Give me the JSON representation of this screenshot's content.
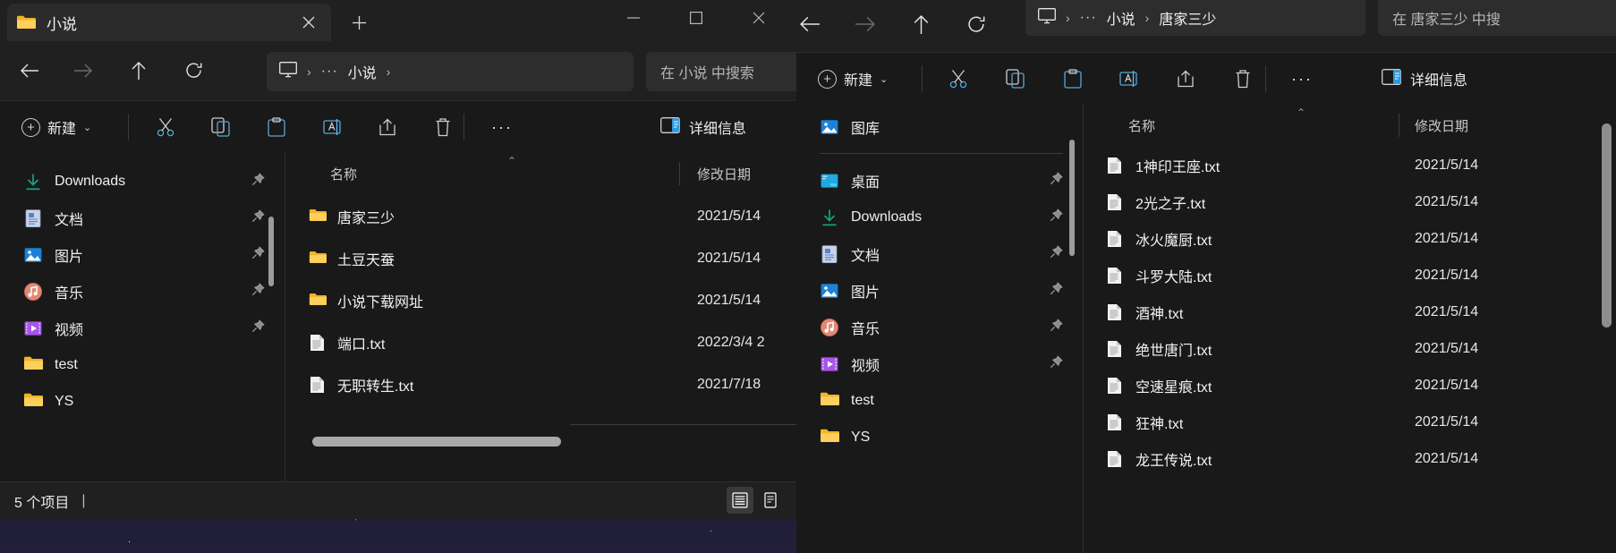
{
  "colors": {
    "accent": "#4cc2ff",
    "folder": "#f5c147",
    "window_bg": "#202020",
    "content_bg": "#191919",
    "text": "#f2f2f2"
  },
  "window1": {
    "tab": {
      "label": "小说",
      "close_tooltip": "×",
      "new_tab": "+"
    },
    "window_controls": {
      "minimize": "—",
      "maximize": "□",
      "close": "✕"
    },
    "nav": {
      "back": "←",
      "forward": "→",
      "up": "↑",
      "refresh": "⟳"
    },
    "address": {
      "pc_icon": "this-pc-icon",
      "overflow": "···",
      "crumbs": [
        "小说"
      ],
      "separator": "›"
    },
    "search": {
      "placeholder": "在 小说 中搜索"
    },
    "toolbar": {
      "new_label": "新建",
      "cut": "剪切",
      "copy": "复制",
      "paste": "粘贴",
      "rename": "重命名",
      "share": "共享",
      "delete": "删除",
      "more": "···",
      "details_label": "详细信息"
    },
    "sidebar": {
      "items": [
        {
          "label": "Downloads",
          "icon": "downloads-icon",
          "pinned": true
        },
        {
          "label": "文档",
          "icon": "documents-icon",
          "pinned": true
        },
        {
          "label": "图片",
          "icon": "pictures-icon",
          "pinned": true
        },
        {
          "label": "音乐",
          "icon": "music-icon",
          "pinned": true
        },
        {
          "label": "视频",
          "icon": "videos-icon",
          "pinned": true
        },
        {
          "label": "test",
          "icon": "folder-icon",
          "pinned": false
        },
        {
          "label": "YS",
          "icon": "folder-icon",
          "pinned": false
        }
      ]
    },
    "filelist": {
      "columns": [
        "名称",
        "修改日期"
      ],
      "rows": [
        {
          "name": "唐家三少",
          "type": "folder",
          "date": "2021/5/14"
        },
        {
          "name": "土豆天蚕",
          "type": "folder",
          "date": "2021/5/14"
        },
        {
          "name": "小说下载网址",
          "type": "folder",
          "date": "2021/5/14"
        },
        {
          "name": "端口.txt",
          "type": "file",
          "date": "2022/3/4 2"
        },
        {
          "name": "无职转生.txt",
          "type": "file",
          "date": "2021/7/18"
        }
      ]
    },
    "status": {
      "items_text": "5 个项目",
      "separator": "|"
    },
    "view_modes": {
      "list": "list-view-icon",
      "details": "details-pane-icon"
    }
  },
  "window2": {
    "nav": {
      "back": "←",
      "forward": "→",
      "up": "↑",
      "refresh": "⟳"
    },
    "address": {
      "pc_icon": "this-pc-icon",
      "overflow": "···",
      "crumbs": [
        "小说",
        "唐家三少"
      ],
      "separator": "›"
    },
    "search": {
      "placeholder": "在 唐家三少 中搜"
    },
    "toolbar": {
      "new_label": "新建",
      "cut": "剪切",
      "copy": "复制",
      "paste": "粘贴",
      "rename": "重命名",
      "share": "共享",
      "delete": "删除",
      "more": "···",
      "details_label": "详细信息"
    },
    "sidebar": {
      "gallery": {
        "label": "图库",
        "icon": "gallery-icon"
      },
      "items": [
        {
          "label": "桌面",
          "icon": "desktop-icon",
          "pinned": true
        },
        {
          "label": "Downloads",
          "icon": "downloads-icon",
          "pinned": true
        },
        {
          "label": "文档",
          "icon": "documents-icon",
          "pinned": true
        },
        {
          "label": "图片",
          "icon": "pictures-icon",
          "pinned": true
        },
        {
          "label": "音乐",
          "icon": "music-icon",
          "pinned": true
        },
        {
          "label": "视频",
          "icon": "videos-icon",
          "pinned": true
        },
        {
          "label": "test",
          "icon": "folder-icon",
          "pinned": false
        },
        {
          "label": "YS",
          "icon": "folder-icon",
          "pinned": false
        }
      ]
    },
    "filelist": {
      "columns": [
        "名称",
        "修改日期"
      ],
      "rows": [
        {
          "name": "1神印王座.txt",
          "type": "file",
          "date": "2021/5/14"
        },
        {
          "name": "2光之子.txt",
          "type": "file",
          "date": "2021/5/14"
        },
        {
          "name": "冰火魔厨.txt",
          "type": "file",
          "date": "2021/5/14"
        },
        {
          "name": "斗罗大陆.txt",
          "type": "file",
          "date": "2021/5/14"
        },
        {
          "name": "酒神.txt",
          "type": "file",
          "date": "2021/5/14"
        },
        {
          "name": "绝世唐门.txt",
          "type": "file",
          "date": "2021/5/14"
        },
        {
          "name": "空速星痕.txt",
          "type": "file",
          "date": "2021/5/14"
        },
        {
          "name": "狂神.txt",
          "type": "file",
          "date": "2021/5/14"
        },
        {
          "name": "龙王传说.txt",
          "type": "file",
          "date": "2021/5/14"
        }
      ]
    }
  }
}
